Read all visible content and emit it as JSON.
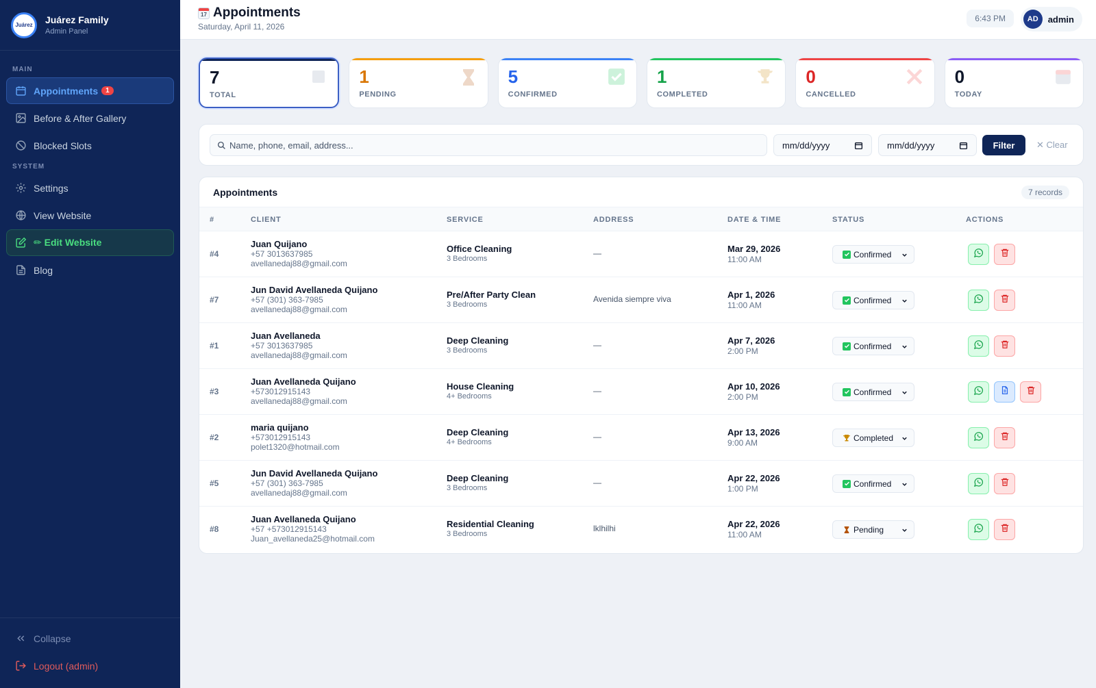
{
  "sidebar": {
    "brand_name": "Juárez Family",
    "brand_sub": "Admin Panel",
    "logo_text": "Juárez",
    "section_main": "MAIN",
    "section_system": "SYSTEM",
    "items": {
      "appointments": "Appointments",
      "appointments_badge": "1",
      "gallery": "Before & After Gallery",
      "blocked": "Blocked Slots",
      "settings": "Settings",
      "view_website": "View Website",
      "edit_website": "✏ Edit Website",
      "blog": "Blog"
    },
    "collapse": "Collapse",
    "logout": "Logout (admin)"
  },
  "header": {
    "title": "Appointments",
    "date": "Saturday, April 11, 2026",
    "time": "6:43 PM",
    "avatar_initials": "AD",
    "user": "admin",
    "cal_number": "17"
  },
  "stats": {
    "total": {
      "value": "7",
      "label": "TOTAL",
      "color": "#0f172a"
    },
    "pending": {
      "value": "1",
      "label": "PENDING",
      "color": "#d97706"
    },
    "confirmed": {
      "value": "5",
      "label": "CONFIRMED",
      "color": "#2563eb"
    },
    "completed": {
      "value": "1",
      "label": "COMPLETED",
      "color": "#16a34a"
    },
    "cancelled": {
      "value": "0",
      "label": "CANCELLED",
      "color": "#dc2626"
    },
    "today": {
      "value": "0",
      "label": "TODAY",
      "color": "#0f172a"
    }
  },
  "filter": {
    "search_placeholder": "Name, phone, email, address...",
    "date_from": "mm/dd/yyyy",
    "date_to": "mm/dd/yyyy",
    "filter_label": "Filter",
    "clear_label": "✕ Clear"
  },
  "table": {
    "title": "Appointments",
    "records": "7 records",
    "headers": {
      "id": "#",
      "client": "CLIENT",
      "service": "SERVICE",
      "address": "ADDRESS",
      "datetime": "DATE & TIME",
      "status": "STATUS",
      "actions": "ACTIONS"
    },
    "rows": [
      {
        "id": "#4",
        "name": "Juan Quijano",
        "phone": "+57 3013637985",
        "email": "avellanedaj88@gmail.com",
        "service": "Office Cleaning",
        "bedrooms": "3 Bedrooms",
        "address": "—",
        "date": "Mar 29, 2026",
        "time": "11:00 AM",
        "status": "Confirmed"
      },
      {
        "id": "#7",
        "name": "Jun David Avellaneda Quijano",
        "phone": "+57 (301) 363-7985",
        "email": "avellanedaj88@gmail.com",
        "service": "Pre/After Party Clean",
        "bedrooms": "3 Bedrooms",
        "address": "Avenida siempre viva",
        "date": "Apr 1, 2026",
        "time": "11:00 AM",
        "status": "Confirmed"
      },
      {
        "id": "#1",
        "name": "Juan Avellaneda",
        "phone": "+57 3013637985",
        "email": "avellanedaj88@gmail.com",
        "service": "Deep Cleaning",
        "bedrooms": "3 Bedrooms",
        "address": "—",
        "date": "Apr 7, 2026",
        "time": "2:00 PM",
        "status": "Confirmed"
      },
      {
        "id": "#3",
        "name": "Juan Avellaneda Quijano",
        "phone": "+573012915143",
        "email": "avellanedaj88@gmail.com",
        "service": "House Cleaning",
        "bedrooms": "4+ Bedrooms",
        "address": "—",
        "date": "Apr 10, 2026",
        "time": "2:00 PM",
        "status": "Confirmed"
      },
      {
        "id": "#2",
        "name": "maria quijano",
        "phone": "+573012915143",
        "email": "polet1320@hotmail.com",
        "service": "Deep Cleaning",
        "bedrooms": "4+ Bedrooms",
        "address": "—",
        "date": "Apr 13, 2026",
        "time": "9:00 AM",
        "status": "Completed"
      },
      {
        "id": "#5",
        "name": "Jun David Avellaneda Quijano",
        "phone": "+57 (301) 363-7985",
        "email": "avellanedaj88@gmail.com",
        "service": "Deep Cleaning",
        "bedrooms": "3 Bedrooms",
        "address": "—",
        "date": "Apr 22, 2026",
        "time": "1:00 PM",
        "status": "Confirmed"
      },
      {
        "id": "#8",
        "name": "Juan Avellaneda Quijano",
        "phone": "+57 +573012915143",
        "email": "Juan_avellaneda25@hotmail.com",
        "service": "Residential Cleaning",
        "bedrooms": "3 Bedrooms",
        "address": "lklhilhi",
        "date": "Apr 22, 2026",
        "time": "11:00 AM",
        "status": "Pending"
      }
    ]
  }
}
